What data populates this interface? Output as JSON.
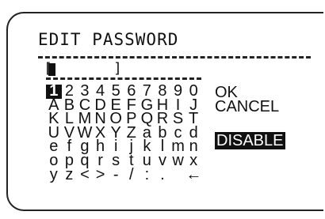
{
  "title": "EDIT PASSWORD",
  "entry": {
    "start": "[",
    "end": "]"
  },
  "keyboard": {
    "rows": [
      [
        "1",
        "2",
        "3",
        "4",
        "5",
        "6",
        "7",
        "8",
        "9",
        "0"
      ],
      [
        "A",
        "B",
        "C",
        "D",
        "E",
        "F",
        "G",
        "H",
        "I",
        "J"
      ],
      [
        "K",
        "L",
        "M",
        "N",
        "O",
        "P",
        "Q",
        "R",
        "S",
        "T"
      ],
      [
        "U",
        "V",
        "W",
        "X",
        "Y",
        "Z",
        "a",
        "b",
        "c",
        "d"
      ],
      [
        "e",
        "f",
        "g",
        "h",
        "i",
        "j",
        "k",
        "l",
        "m",
        "n"
      ],
      [
        "o",
        "p",
        "q",
        "r",
        "s",
        "t",
        "u",
        "v",
        "w",
        "x"
      ],
      [
        "y",
        "z",
        "<",
        ">",
        "-",
        "/",
        ":",
        ".",
        "",
        "←"
      ]
    ],
    "selected": "1"
  },
  "menu": {
    "ok": "OK",
    "cancel": "CANCEL",
    "disable": "DISABLE"
  },
  "colors": {
    "foreground": "#111111",
    "background": "#ffffff"
  }
}
